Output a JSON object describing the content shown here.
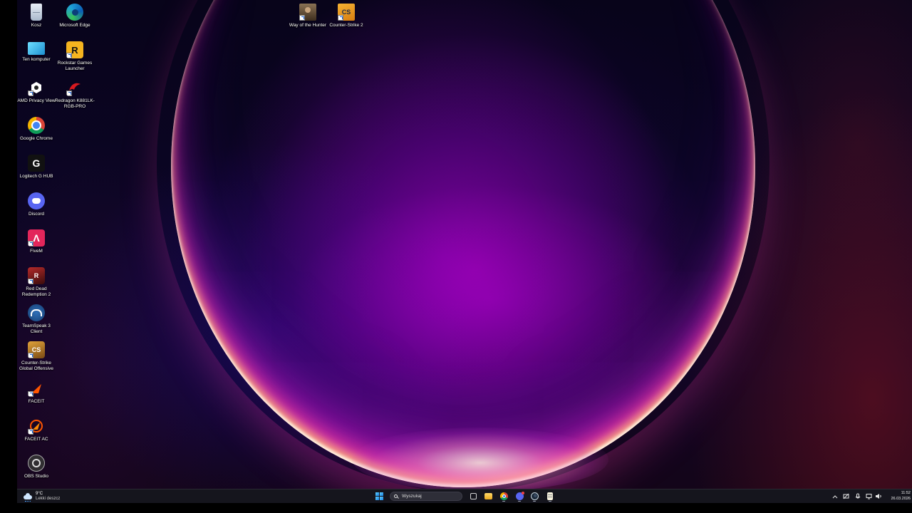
{
  "desktop": {
    "icons": [
      {
        "label": "Kosz",
        "icon": "recycle-bin-icon",
        "color": "#c9d6e6"
      },
      {
        "label": "Microsoft Edge",
        "icon": "edge-icon",
        "color": "#1fa1d8"
      },
      {
        "label": "Ten komputer",
        "icon": "monitor-icon",
        "color": "#3fc0e6"
      },
      {
        "label": "Rockstar Games Launcher",
        "icon": "rockstar-icon",
        "color": "#f5b41f"
      },
      {
        "label": "AMD Privacy View",
        "icon": "amd-privacy-icon",
        "color": "#ffffff"
      },
      {
        "label": "Redragon K881LK-RGB-PRO",
        "icon": "redragon-icon",
        "color": "#d7191f"
      },
      {
        "label": "Google Chrome",
        "icon": "chrome-icon",
        "color": "#4285f4"
      },
      {
        "label": "Logitech G HUB",
        "icon": "logitech-icon",
        "color": "#111111"
      },
      {
        "label": "Discord",
        "icon": "discord-icon",
        "color": "#5865f2"
      },
      {
        "label": "FiveM",
        "icon": "fivem-icon",
        "color": "#e3265b"
      },
      {
        "label": "Red Dead Redemption 2",
        "icon": "rdr2-icon",
        "color": "#8e1b1b"
      },
      {
        "label": "TeamSpeak 3 Client",
        "icon": "teamspeak-icon",
        "color": "#1e4e8c"
      },
      {
        "label": "Counter-Strike Global Offensive",
        "icon": "csgo-icon",
        "color": "#c98b2d"
      },
      {
        "label": "FACEIT",
        "icon": "faceit-icon",
        "color": "#ff5500"
      },
      {
        "label": "FACEIT AC",
        "icon": "faceit-ac-icon",
        "color": "#ff5500"
      },
      {
        "label": "OBS Studio",
        "icon": "obs-icon",
        "color": "#302e31"
      },
      {
        "label": "Way of the Hunter",
        "icon": "way-of-the-hunter-icon",
        "color": "#5a4632"
      },
      {
        "label": "Counter-Strike 2",
        "icon": "cs2-icon",
        "color": "#f0a21d"
      }
    ]
  },
  "taskbar": {
    "weather": {
      "temperature": "9°C",
      "description": "Lekki deszcz",
      "icon": "rain-cloud-icon"
    },
    "start_icon": "windows-start-icon",
    "search_placeholder": "Wyszukaj",
    "pinned_apps": [
      {
        "name": "Task View",
        "icon": "task-view-icon",
        "color": "#d0d0d0"
      },
      {
        "name": "File Explorer",
        "icon": "file-explorer-icon",
        "color": "#f7c845"
      },
      {
        "name": "Google Chrome",
        "icon": "chrome-icon",
        "color": "#4285f4"
      },
      {
        "name": "Discord",
        "icon": "discord-icon",
        "color": "#5865f2"
      },
      {
        "name": "Steam",
        "icon": "steam-icon",
        "color": "#c7d5e0"
      },
      {
        "name": "Notepad",
        "icon": "notepad-icon",
        "color": "#f5f0dc"
      }
    ],
    "tray_icons": [
      "chevron-up-icon",
      "network-icon",
      "microphone-icon",
      "display-icon",
      "volume-icon"
    ],
    "clock": {
      "time": "11:52",
      "date": "26.03.2026"
    }
  }
}
